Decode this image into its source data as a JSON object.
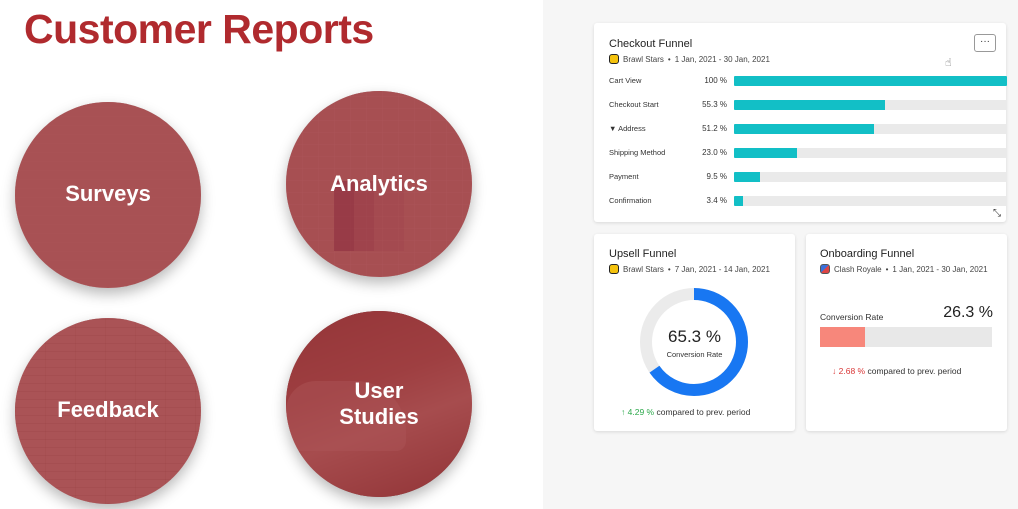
{
  "page_title": "Customer Reports",
  "circles": {
    "surveys": "Surveys",
    "analytics": "Analytics",
    "feedback": "Feedback",
    "user_studies_line1": "User",
    "user_studies_line2": "Studies"
  },
  "checkout_funnel": {
    "title": "Checkout Funnel",
    "game": "Brawl Stars",
    "date_range": "1 Jan, 2021 - 30 Jan, 2021",
    "menu_label": "···",
    "steps": [
      {
        "name": "Cart View",
        "value_label": "100 %",
        "value": 100
      },
      {
        "name": "Checkout Start",
        "value_label": "55.3 %",
        "value": 55.3
      },
      {
        "name": "▼ Address",
        "value_label": "51.2 %",
        "value": 51.2
      },
      {
        "name": "Shipping Method",
        "value_label": "23.0 %",
        "value": 23.0
      },
      {
        "name": "Payment",
        "value_label": "9.5 %",
        "value": 9.5
      },
      {
        "name": "Confirmation",
        "value_label": "3.4 %",
        "value": 3.4
      }
    ],
    "bar_color": "#12bfc6"
  },
  "upsell_funnel": {
    "title": "Upsell Funnel",
    "game": "Brawl Stars",
    "date_range": "7 Jan, 2021 - 14 Jan, 2021",
    "value_label": "65.3 %",
    "value": 65.3,
    "metric_label": "Conversion Rate",
    "delta_value": "4.29 %",
    "delta_text": "compared to prev. period",
    "ring_color": "#1877f2"
  },
  "onboarding_funnel": {
    "title": "Onboarding Funnel",
    "game": "Clash Royale",
    "date_range": "1 Jan, 2021 - 30 Jan, 2021",
    "metric_label": "Conversion Rate",
    "value_label": "26.3 %",
    "value": 26.3,
    "delta_value": "2.68 %",
    "delta_text": "compared to prev. period",
    "bar_color": "#f7877b"
  }
}
